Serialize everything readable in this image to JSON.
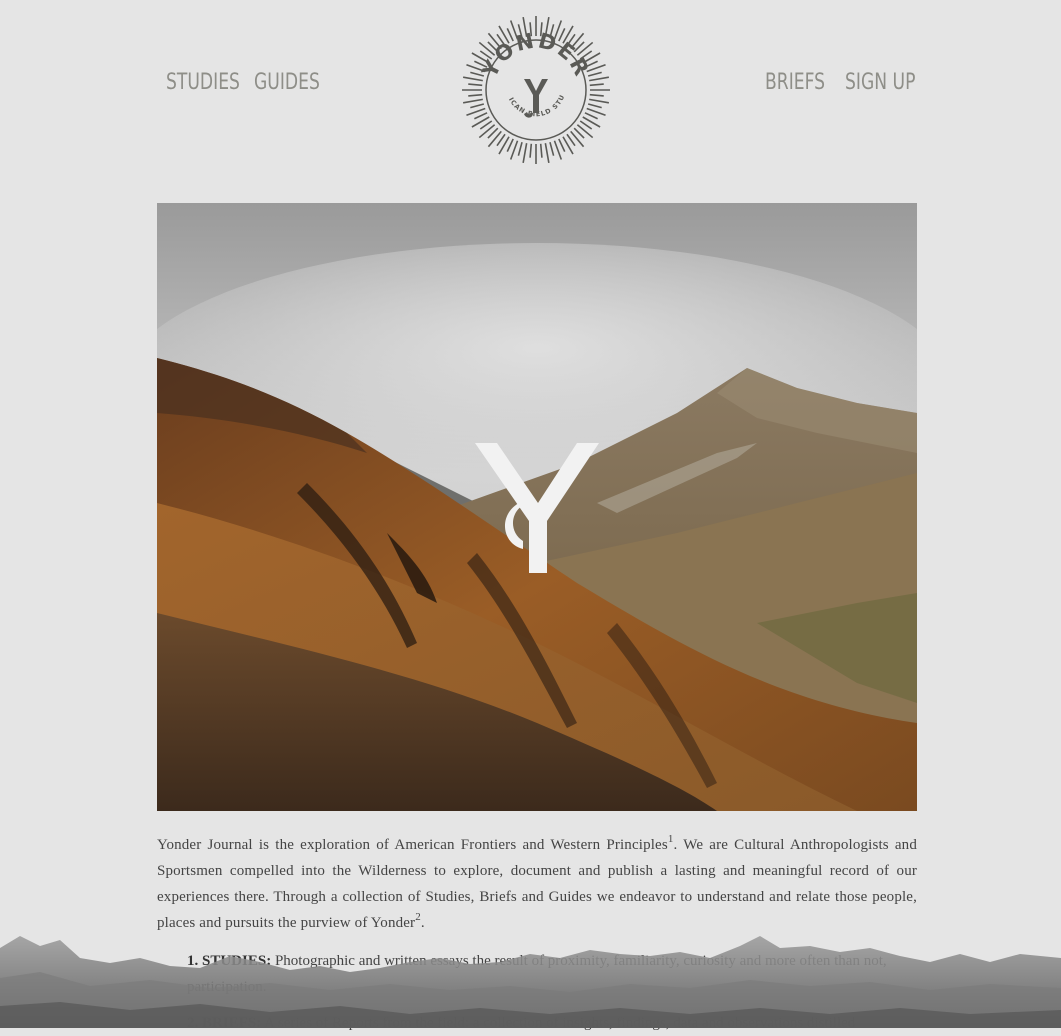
{
  "nav": {
    "studies": "STUDIES",
    "guides": "GUIDES",
    "briefs": "BRIEFS",
    "sign_up": "SIGN UP"
  },
  "logo": {
    "wordmark": "YONDER",
    "tagline": "AMERICAN FIELD STUDIES"
  },
  "intro": {
    "part1": "Yonder Journal is the exploration of American Frontiers and Western Principles",
    "sup1": "1",
    "part2": ". We are Cultural Anthropologists and Sportsmen compelled into the Wilderness to explore, document and publish a lasting and meaningful record of our experiences there. Through a collection of Studies, Briefs and Guides we endeavor to understand and relate those people, places and pursuits the purview of Yonder",
    "sup2": "2",
    "part3": "."
  },
  "list": [
    {
      "label": "1. STUDIES:",
      "text": "Photographic and written essays the result of proximity, familiarity, curiosity and more often than not, participation."
    },
    {
      "label": "2. BRIEFS:",
      "text": "A series of Reports from the field: a collection of insights, findings, data and observations distilled"
    }
  ],
  "colors": {
    "background": "#e5e5e5",
    "nav_text": "#8e8e88",
    "logo": "#5a5a56",
    "body_text": "#444444"
  }
}
